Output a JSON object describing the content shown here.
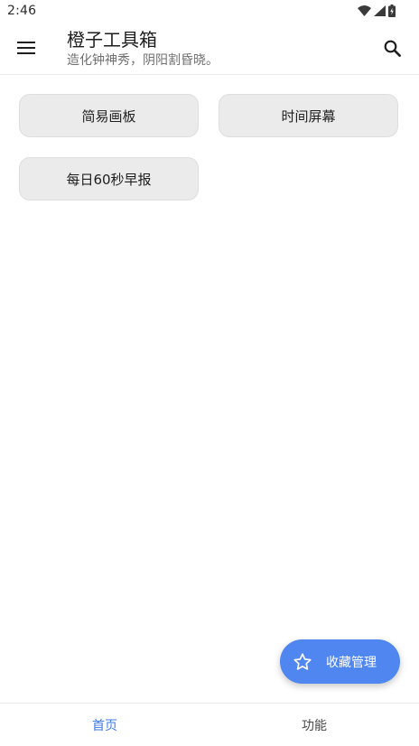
{
  "status_bar": {
    "time": "2:46",
    "icons": [
      "wifi-icon",
      "cell-signal-icon",
      "battery-charging-icon"
    ]
  },
  "app_bar": {
    "menu_icon": "menu-icon",
    "title": "橙子工具箱",
    "subtitle": "造化钟神秀，阴阳割昏晓。",
    "search_icon": "search-icon"
  },
  "tools": [
    {
      "label": "简易画板"
    },
    {
      "label": "时间屏幕"
    },
    {
      "label": "每日60秒早报"
    }
  ],
  "fab": {
    "icon": "star-outline-icon",
    "label": "收藏管理",
    "color": "#4f86f0"
  },
  "bottom_nav": {
    "items": [
      {
        "label": "首页",
        "active": true
      },
      {
        "label": "功能",
        "active": false
      }
    ],
    "active_color": "#3d7ae6"
  }
}
